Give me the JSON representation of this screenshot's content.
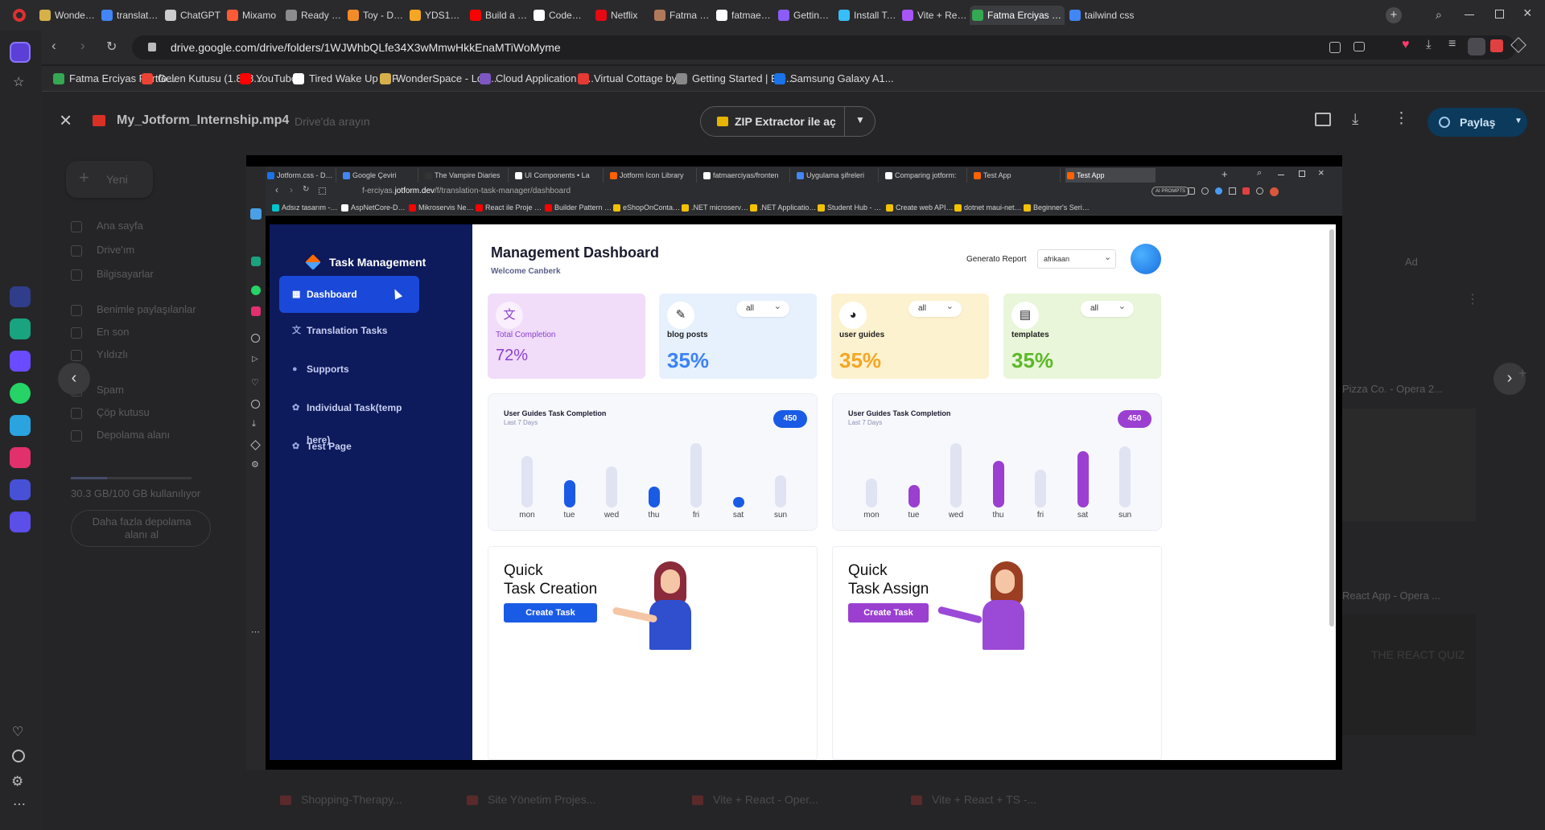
{
  "outer_tabs": [
    {
      "label": "WonderSpa",
      "color": "#d6b14a"
    },
    {
      "label": "translate - G",
      "color": "#4285f4"
    },
    {
      "label": "ChatGPT",
      "color": "#cccccc"
    },
    {
      "label": "Mixamo",
      "color": "#ff5a36"
    },
    {
      "label": "Ready Playe",
      "color": "#8c8c8c"
    },
    {
      "label": "Toy - Downl",
      "color": "#f28c28"
    },
    {
      "label": "YDS1_ingiliz",
      "color": "#f5a623"
    },
    {
      "label": "Build a 3D E",
      "color": "#ff0000"
    },
    {
      "label": "CodeWithG",
      "color": "#ffffff"
    },
    {
      "label": "Netflix",
      "color": "#e50914"
    },
    {
      "label": "Fatma Erciya",
      "color": "#b07a5a"
    },
    {
      "label": "fatmaerciya",
      "color": "#ffffff"
    },
    {
      "label": "Getting Star",
      "color": "#8b5cf6"
    },
    {
      "label": "Install Tailw",
      "color": "#38bdf8"
    },
    {
      "label": "Vite + React",
      "color": "#a855f7"
    },
    {
      "label": "Fatma Erciyas Portfol",
      "color": "#34a853"
    },
    {
      "label": "tailwind css",
      "color": "#4285f4"
    }
  ],
  "outer_url": "drive.google.com/drive/folders/1WJWhbQLfe34X3wMmwHkkEnaMTiWoMyme",
  "bookmarks": [
    {
      "label": "Fatma Erciyas Portfo...",
      "color": "#34a853"
    },
    {
      "label": "Gelen Kutusu (1.878...",
      "color": "#ea4335"
    },
    {
      "label": "YouTube",
      "color": "#ff0000"
    },
    {
      "label": "Tired Wake Up GIF",
      "color": "#ffffff"
    },
    {
      "label": "WonderSpace - Lofi...",
      "color": "#d6b14a"
    },
    {
      "label": "Cloud Application P...",
      "color": "#7e57c2"
    },
    {
      "label": "Virtual Cottage by...",
      "color": "#e53935"
    },
    {
      "label": "Getting Started | Ele...",
      "color": "#888888"
    },
    {
      "label": "Samsung Galaxy A1...",
      "color": "#1a73e8"
    }
  ],
  "drive": {
    "file_title": "My_Jotform_Internship.mp4",
    "search_placeholder": "Drive'da arayın",
    "zip_label": "ZIP Extractor ile aç",
    "share_label": "Paylaş",
    "new_label": "Yeni",
    "nav": [
      "Ana sayfa",
      "Drive'ım",
      "Bilgisayarlar",
      "Benimle paylaşılanlar",
      "En son",
      "Yıldızlı",
      "Spam",
      "Çöp kutusu",
      "Depolama alanı"
    ],
    "storage_text": "30.3 GB/100 GB kullanılıyor",
    "more_storage": "Daha fazla depolama alanı al",
    "sort_label": "Ad",
    "bottom_files": [
      "Shopping-Therapy...",
      "Site Yönetim Projes...",
      "Vite + React - Oper...",
      "Vite + React + TS -..."
    ],
    "right_file_1": "Pizza Co. - Opera 2...",
    "right_file_2": "React App - Opera ...",
    "quiz_title": "THE REACT QUIZ"
  },
  "inner_tabs": [
    {
      "label": "Jotform.css - Docum",
      "color": "#1a73e8"
    },
    {
      "label": "Google Çeviri",
      "color": "#4285f4"
    },
    {
      "label": "The Vampire Diaries",
      "color": "#333333"
    },
    {
      "label": "UI Components • La",
      "color": "#ffffff"
    },
    {
      "label": "Jotform Icon Library",
      "color": "#ff6100"
    },
    {
      "label": "fatmaerciyas/fronten",
      "color": "#ffffff"
    },
    {
      "label": "Uygulama şifreleri",
      "color": "#4285f4"
    },
    {
      "label": "Comparing jotform:",
      "color": "#ffffff"
    },
    {
      "label": "Test App",
      "color": "#ff6100"
    },
    {
      "label": "Test App",
      "color": "#ff6100"
    }
  ],
  "inner_url_prefix": "f-erciyas.",
  "inner_url_domain": "jotform.dev",
  "inner_url_path": "/f/translation-task-manager/dashboard",
  "ai_prompts": "AI PROMPTS",
  "inner_bookmarks": [
    {
      "label": "Adsız tasarım - Insta...",
      "color": "#00c4cc"
    },
    {
      "label": "AspNetCore-Devel...",
      "color": "#ffffff"
    },
    {
      "label": "Mikroservis Nedir |...",
      "color": "#ff0000"
    },
    {
      "label": "React ile Proje Geliş...",
      "color": "#ff0000"
    },
    {
      "label": "Builder Pattern | De...",
      "color": "#ff0000"
    },
    {
      "label": "eShopOnContainer...",
      "color": "#f2c200"
    },
    {
      "label": ".NET microservices...",
      "color": "#f2c200"
    },
    {
      "label": ".NET Application Ar...",
      "color": "#f2c200"
    },
    {
      "label": "Student Hub - Stud...",
      "color": "#f2c200"
    },
    {
      "label": "Create web APIs wit...",
      "color": "#f2c200"
    },
    {
      "label": "dotnet maui-net-m...",
      "color": "#f2c200"
    },
    {
      "label": "Beginner's Series to...",
      "color": "#f2c200"
    }
  ],
  "app": {
    "brand": "Task Management",
    "nav": [
      {
        "label": "Dashboard",
        "icon": "grid-icon"
      },
      {
        "label": "Translation Tasks",
        "icon": "translate-icon"
      },
      {
        "label": "Supports",
        "icon": "user-icon"
      },
      {
        "label": "Individual Task(temp here)",
        "icon": "gear-icon"
      },
      {
        "label": "Test Page",
        "icon": "gear-icon"
      }
    ],
    "title": "Management Dashboard",
    "welcome": "Welcome Canberk",
    "report_label": "Generato Report",
    "language_value": "afrikaan",
    "kpis": [
      {
        "label": "Total Completion",
        "value": "72%",
        "icon": "translate-icon",
        "bg": "#f1dcfa",
        "fg": "#8a3fd1",
        "dropdown": ""
      },
      {
        "label": "blog posts",
        "value": "35%",
        "icon": "pen-icon",
        "bg": "#e6f1fd",
        "fg": "#3b82f6",
        "dropdown": "all"
      },
      {
        "label": "user guides",
        "value": "35%",
        "icon": "person-icon",
        "bg": "#fdf2d0",
        "fg": "#f5a623",
        "dropdown": "all"
      },
      {
        "label": "templates",
        "value": "35%",
        "icon": "document-icon",
        "bg": "#e9f6d9",
        "fg": "#5cb82a",
        "dropdown": "all"
      }
    ],
    "charts": [
      {
        "title": "User Guides Task Completion",
        "subtitle": "Last 7 Days",
        "badge": "450",
        "accent": "#1a5be6"
      },
      {
        "title": "User Guides Task Completion",
        "subtitle": "Last 7 Days",
        "badge": "450",
        "accent": "#9b3fd1"
      }
    ],
    "quick": [
      {
        "line1": "Quick",
        "line2": "Task Creation",
        "button": "Create Task",
        "btn_color": "#1a5be6"
      },
      {
        "line1": "Quick",
        "line2": "Task Assign",
        "button": "Create Task",
        "btn_color": "#9b3fd1"
      }
    ]
  },
  "chart_data": [
    {
      "type": "bar",
      "title": "User Guides Task Completion",
      "subtitle": "Last 7 Days",
      "categories": [
        "mon",
        "tue",
        "wed",
        "thu",
        "fri",
        "sat",
        "sun"
      ],
      "values": [
        80,
        42,
        64,
        33,
        100,
        16,
        50
      ],
      "highlighted": [
        false,
        true,
        false,
        true,
        false,
        true,
        false
      ],
      "ylim": [
        0,
        100
      ]
    },
    {
      "type": "bar",
      "title": "User Guides Task Completion",
      "subtitle": "Last 7 Days",
      "categories": [
        "mon",
        "tue",
        "wed",
        "thu",
        "fri",
        "sat",
        "sun"
      ],
      "values": [
        45,
        35,
        100,
        72,
        59,
        87,
        95
      ],
      "highlighted": [
        false,
        true,
        false,
        true,
        false,
        true,
        false
      ],
      "ylim": [
        0,
        100
      ]
    }
  ]
}
